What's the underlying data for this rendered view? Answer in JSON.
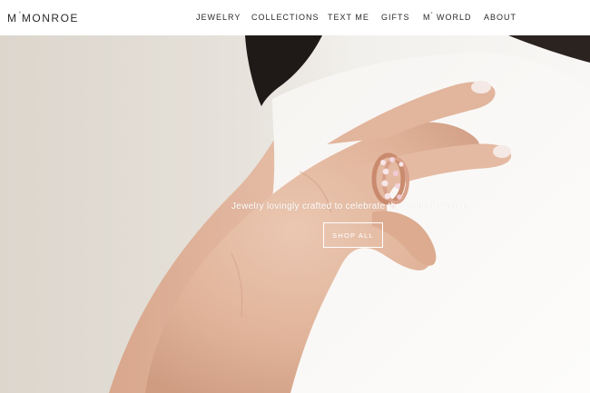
{
  "header": {
    "logo": {
      "prefix": "M",
      "mark": "°",
      "name": "MONROE"
    },
    "nav": [
      {
        "label": "JEWELRY"
      },
      {
        "label": "COLLECTIONS"
      },
      {
        "label": "TEXT ME"
      },
      {
        "label": "GIFTS"
      },
      {
        "prefix": "M",
        "mark": "°",
        "label": "WORLD"
      },
      {
        "label": "ABOUT"
      }
    ]
  },
  "hero": {
    "tagline": "Jewelry lovingly crafted to celebrate the modern woman.",
    "cta_label": "SHOP ALL",
    "image_description": "woman's hand wearing stacked rose gold rings against white top",
    "colors": {
      "skin": "#e4b9a0",
      "shirt": "#fbfaf8",
      "hair": "#1f1a17",
      "ring": "#c98a6e"
    }
  }
}
